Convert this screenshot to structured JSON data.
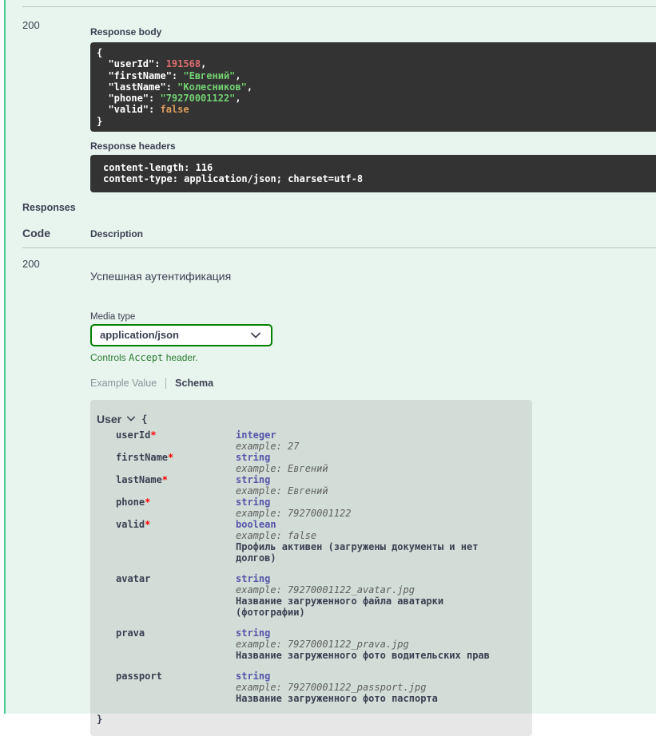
{
  "colors": {
    "accent_green": "#49cc90",
    "page_bg": "#e8f4ee",
    "code_bg": "#333333",
    "token_number": "#e06e6e",
    "token_string": "#73d273",
    "token_boolean": "#df9f5c",
    "type_color": "#5555aa",
    "select_border": "#008000",
    "note_green": "#2e7d32"
  },
  "live_response": {
    "status_code": "200",
    "response_body_label": "Response body",
    "response_body_lines": [
      [
        {
          "t": "p",
          "v": "{"
        }
      ],
      [
        {
          "t": "p",
          "v": "  \"userId\": "
        },
        {
          "t": "num",
          "v": "191568"
        },
        {
          "t": "p",
          "v": ","
        }
      ],
      [
        {
          "t": "p",
          "v": "  \"firstName\": "
        },
        {
          "t": "str",
          "v": "\"Евгений\""
        },
        {
          "t": "p",
          "v": ","
        }
      ],
      [
        {
          "t": "p",
          "v": "  \"lastName\": "
        },
        {
          "t": "str",
          "v": "\"Колесников\""
        },
        {
          "t": "p",
          "v": ","
        }
      ],
      [
        {
          "t": "p",
          "v": "  \"phone\": "
        },
        {
          "t": "str",
          "v": "\"79270001122\""
        },
        {
          "t": "p",
          "v": ","
        }
      ],
      [
        {
          "t": "p",
          "v": "  \"valid\": "
        },
        {
          "t": "bool",
          "v": "false"
        }
      ],
      [
        {
          "t": "p",
          "v": "}"
        }
      ]
    ],
    "response_headers_label": "Response headers",
    "response_headers_lines": [
      "content-length: 116",
      "content-type: application/json; charset=utf-8"
    ]
  },
  "responses": {
    "section_title": "Responses",
    "code_header": "Code",
    "description_header": "Description",
    "row": {
      "code": "200",
      "description": "Успешная аутентификация",
      "media_type_label": "Media type",
      "media_type_selected": "application/json",
      "accept_note_prefix": "Controls ",
      "accept_note_code": "Accept",
      "accept_note_suffix": " header.",
      "tabs": [
        {
          "label": "Example Value",
          "active": false
        },
        {
          "label": "Schema",
          "active": true
        }
      ]
    }
  },
  "model": {
    "name": "User",
    "brace_open": "{",
    "brace_close": "}",
    "example_label": "example: ",
    "fields": [
      {
        "name": "userId",
        "required": true,
        "type": "integer",
        "example": "27",
        "description": ""
      },
      {
        "name": "firstName",
        "required": true,
        "type": "string",
        "example": "Евгений",
        "description": ""
      },
      {
        "name": "lastName",
        "required": true,
        "type": "string",
        "example": "Евгений",
        "description": ""
      },
      {
        "name": "phone",
        "required": true,
        "type": "string",
        "example": "79270001122",
        "description": ""
      },
      {
        "name": "valid",
        "required": true,
        "type": "boolean",
        "example": "false",
        "description": "Профиль активен (загружены документы и нет долгов)"
      },
      {
        "name": "avatar",
        "required": false,
        "type": "string",
        "example": "79270001122_avatar.jpg",
        "description": "Название загруженного файла аватарки (фотографии)"
      },
      {
        "name": "prava",
        "required": false,
        "type": "string",
        "example": "79270001122_prava.jpg",
        "description": "Название загруженного фото водительских прав"
      },
      {
        "name": "passport",
        "required": false,
        "type": "string",
        "example": "79270001122_passport.jpg",
        "description": "Название загруженного фото паспорта"
      }
    ]
  }
}
